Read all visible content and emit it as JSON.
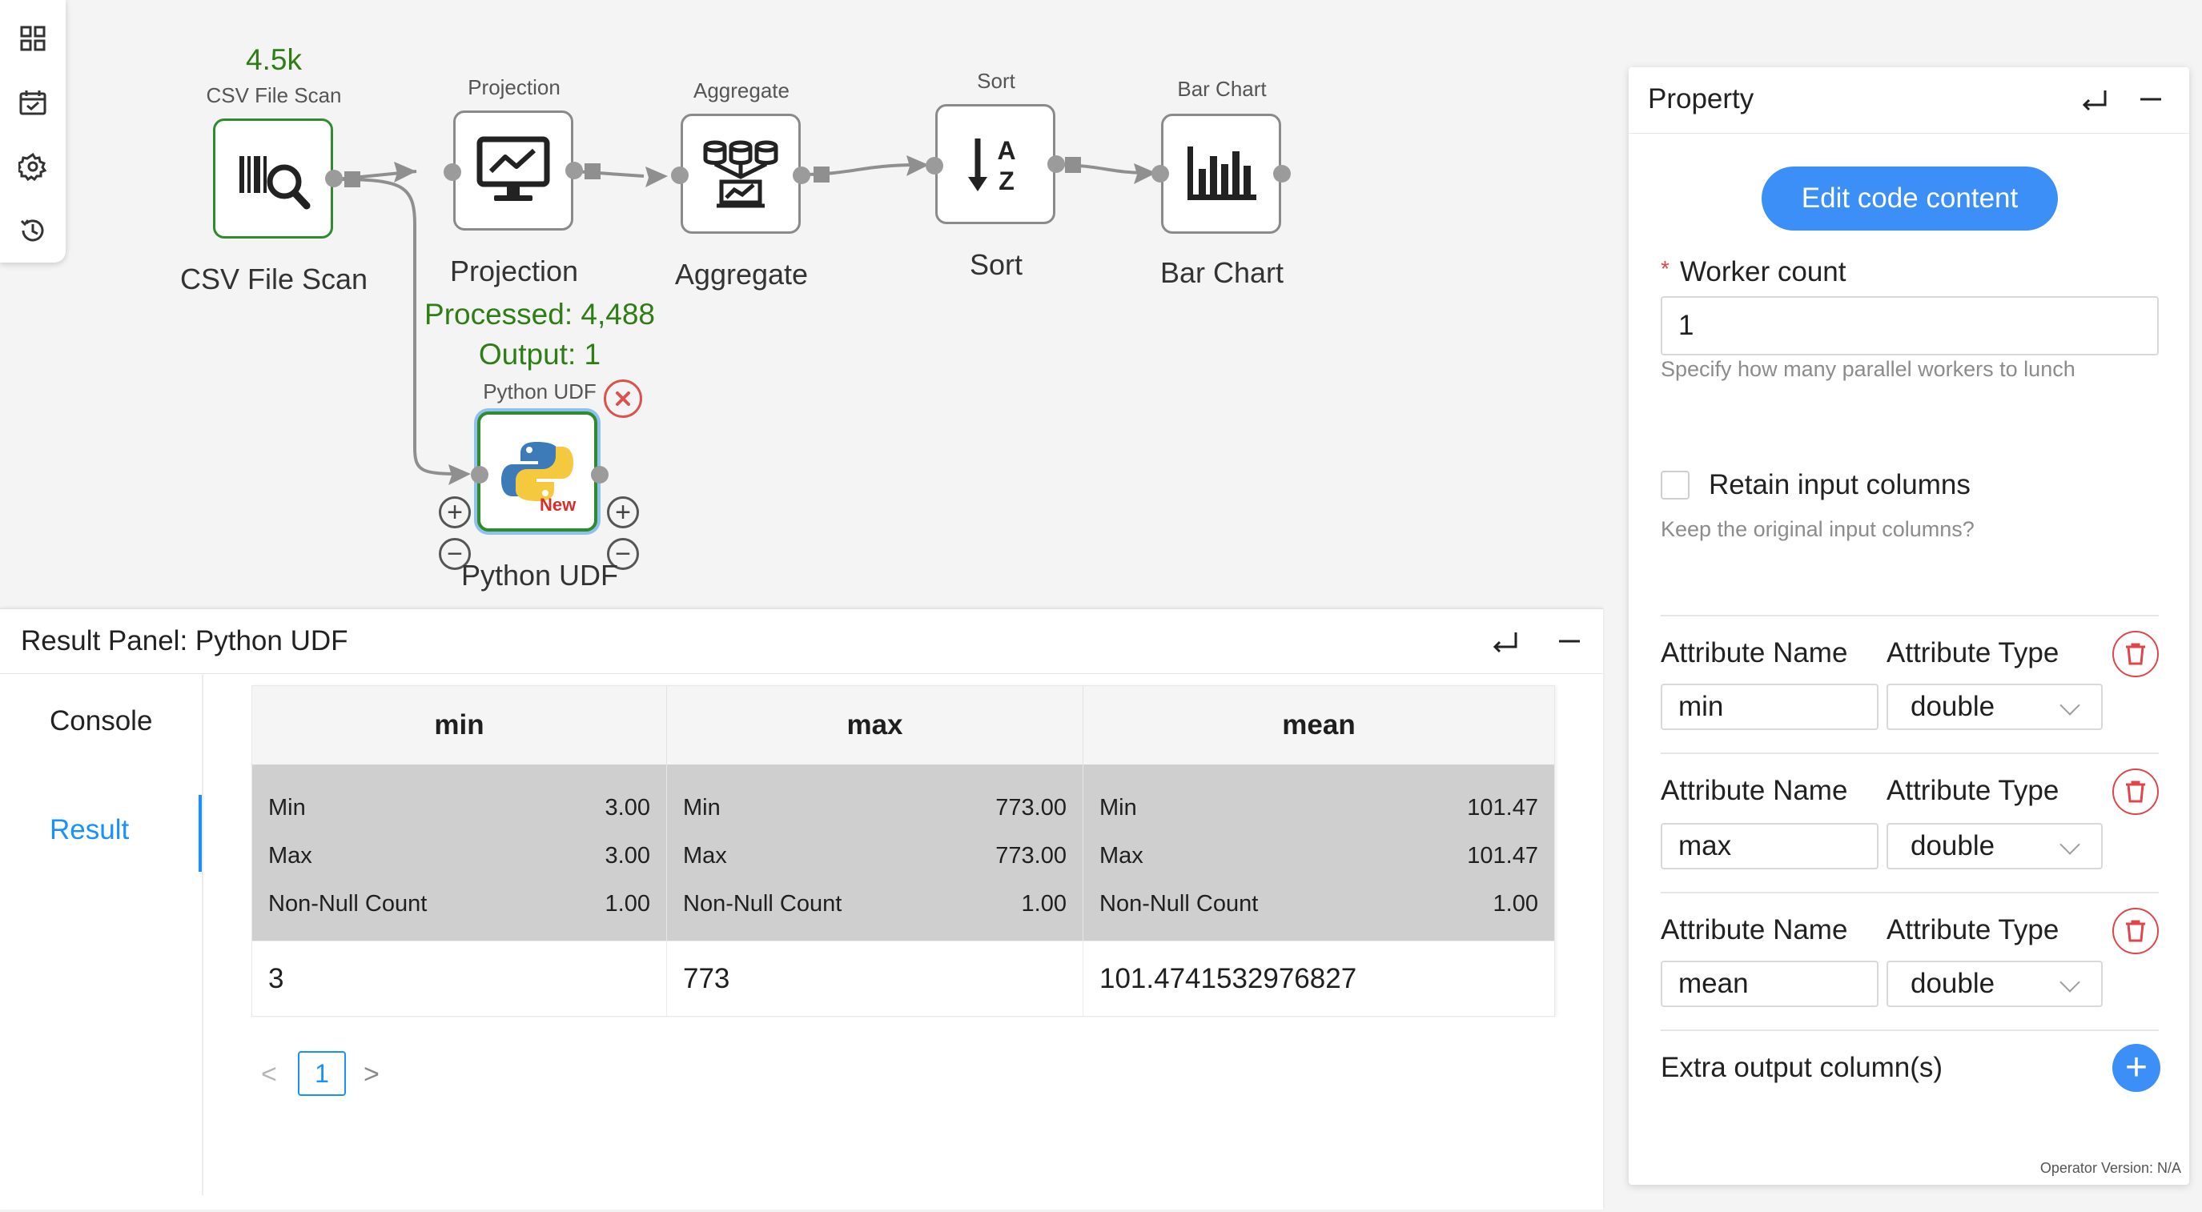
{
  "toolbar": {
    "icons": [
      "grid-icon",
      "calendar-icon",
      "gear-icon",
      "history-icon"
    ]
  },
  "workflow": {
    "operators": [
      {
        "id": "csv",
        "small_label": "CSV File Scan",
        "label": "CSV File Scan",
        "stat": "4.5k",
        "icon": "barcode-search-icon",
        "status_color": "#2e8b2e"
      },
      {
        "id": "projection",
        "small_label": "Projection",
        "label": "Projection",
        "icon": "monitor-chart-icon"
      },
      {
        "id": "aggregate",
        "small_label": "Aggregate",
        "label": "Aggregate",
        "icon": "database-aggregate-icon"
      },
      {
        "id": "sort",
        "small_label": "Sort",
        "label": "Sort",
        "icon": "sort-az-icon"
      },
      {
        "id": "barchart",
        "small_label": "Bar Chart",
        "label": "Bar Chart",
        "icon": "bar-chart-icon"
      },
      {
        "id": "pythonudf",
        "small_label": "Python UDF",
        "label": "Python UDF",
        "icon": "python-icon",
        "badge": "New",
        "status_color": "#2e8b2e",
        "highlight_color": "#4a90e2"
      }
    ],
    "projection_stats": {
      "processed": "Processed: 4,488",
      "output": "Output: 1"
    }
  },
  "result_panel": {
    "title": "Result Panel: Python UDF",
    "tabs": [
      {
        "label": "Console"
      },
      {
        "label": "Result",
        "active": true
      }
    ],
    "columns": [
      "min",
      "max",
      "mean"
    ],
    "stats": [
      [
        {
          "k": "Min",
          "v": "3.00"
        },
        {
          "k": "Max",
          "v": "3.00"
        },
        {
          "k": "Non-Null Count",
          "v": "1.00"
        }
      ],
      [
        {
          "k": "Min",
          "v": "773.00"
        },
        {
          "k": "Max",
          "v": "773.00"
        },
        {
          "k": "Non-Null Count",
          "v": "1.00"
        }
      ],
      [
        {
          "k": "Min",
          "v": "101.47"
        },
        {
          "k": "Max",
          "v": "101.47"
        },
        {
          "k": "Non-Null Count",
          "v": "1.00"
        }
      ]
    ],
    "rows": [
      [
        "3",
        "773",
        "101.4741532976827"
      ]
    ],
    "pagination": {
      "prev": "<",
      "current": "1",
      "next": ">"
    }
  },
  "property_panel": {
    "title": "Property",
    "edit_code_label": "Edit code content",
    "worker_count": {
      "required_mark": "*",
      "label": "Worker count",
      "value": "1",
      "hint": "Specify how many parallel workers to lunch"
    },
    "retain": {
      "label": "Retain input columns",
      "hint": "Keep the original input columns?",
      "checked": false
    },
    "attributes": [
      {
        "name_label": "Attribute Name",
        "type_label": "Attribute Type",
        "name": "min",
        "type": "double"
      },
      {
        "name_label": "Attribute Name",
        "type_label": "Attribute Type",
        "name": "max",
        "type": "double"
      },
      {
        "name_label": "Attribute Name",
        "type_label": "Attribute Type",
        "name": "mean",
        "type": "double"
      }
    ],
    "extra_output_label": "Extra output column(s)",
    "add_label": "+",
    "version": "Operator Version: N/A"
  },
  "colors": {
    "accent": "#3b8ff7",
    "status_green": "#2e7d15",
    "danger": "#e0454a"
  }
}
